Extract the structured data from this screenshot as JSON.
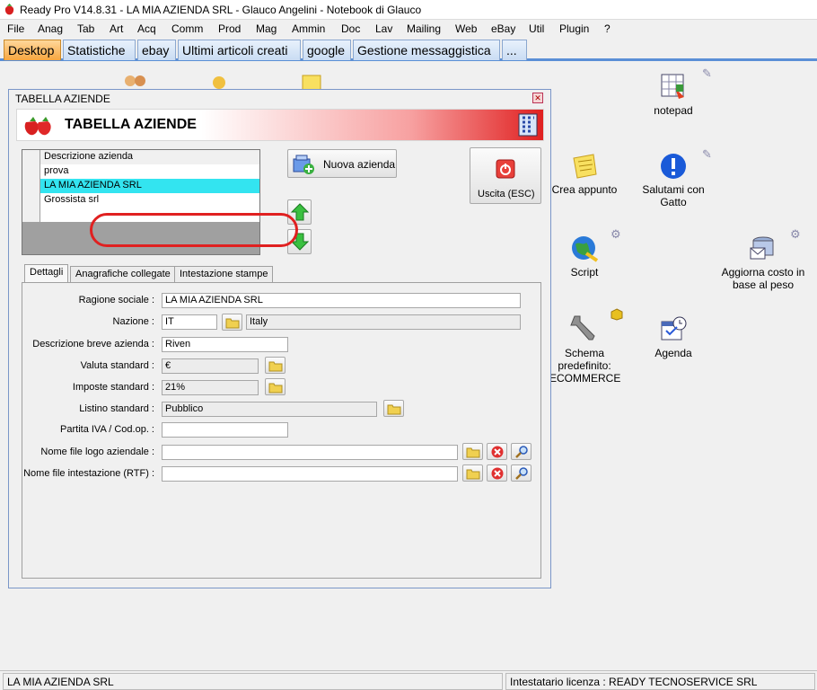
{
  "window": {
    "title": "Ready Pro V14.8.31 - LA MIA AZIENDA SRL - Glauco Angelini - Notebook di Glauco"
  },
  "menu": [
    "File",
    "Anag",
    "Tab",
    "Art",
    "Acq",
    "Comm",
    "Prod",
    "Mag",
    "Ammin",
    "Doc",
    "Lav",
    "Mailing",
    "Web",
    "eBay",
    "Util",
    "Plugin",
    "?"
  ],
  "tabs": [
    {
      "label": "Desktop",
      "active": true
    },
    {
      "label": "Statistiche",
      "active": false
    },
    {
      "label": "ebay",
      "active": false
    },
    {
      "label": "Ultimi articoli creati",
      "active": false
    },
    {
      "label": "google",
      "active": false
    },
    {
      "label": "Gestione messaggistica",
      "active": false
    },
    {
      "label": "...",
      "active": false
    }
  ],
  "desktop_icons": {
    "notepad": "notepad",
    "crea_appunto": "Crea appunto",
    "salutami": "Salutami con Gatto",
    "script": "Script",
    "aggiorna": "Aggiorna costo in base al peso",
    "schema": "Schema predefinito: ECOMMERCE",
    "agenda": "Agenda"
  },
  "dialog": {
    "title": "TABELLA AZIENDE",
    "banner_title": "TABELLA AZIENDE",
    "grid": {
      "header": "Descrizione azienda",
      "rows": [
        "prova",
        "LA MIA AZIENDA SRL",
        "Grossista srl",
        ""
      ]
    },
    "new_button": "Nuova azienda",
    "exit_button": "Uscita (ESC)",
    "tabs": [
      "Dettagli",
      "Anagrafiche collegate",
      "Intestazione stampe"
    ],
    "fields": {
      "ragione_sociale_label": "Ragione sociale :",
      "ragione_sociale": "LA MIA AZIENDA SRL",
      "nazione_label": "Nazione :",
      "nazione_code": "IT",
      "nazione_name": "Italy",
      "descr_breve_label": "Descrizione breve azienda :",
      "descr_breve": "Riven",
      "valuta_label": "Valuta standard :",
      "valuta": "€",
      "imposte_label": "Imposte standard :",
      "imposte": "21%",
      "listino_label": "Listino standard :",
      "listino": "Pubblico",
      "piva_label": "Partita IVA / Cod.op. :",
      "piva": "",
      "logo_label": "Nome file logo aziendale :",
      "logo": "",
      "intest_label": "Nome file intestazione (RTF) :",
      "intest": ""
    }
  },
  "statusbar": {
    "company": "LA MIA AZIENDA SRL",
    "license": "Intestatario licenza : READY TECNOSERVICE SRL"
  }
}
